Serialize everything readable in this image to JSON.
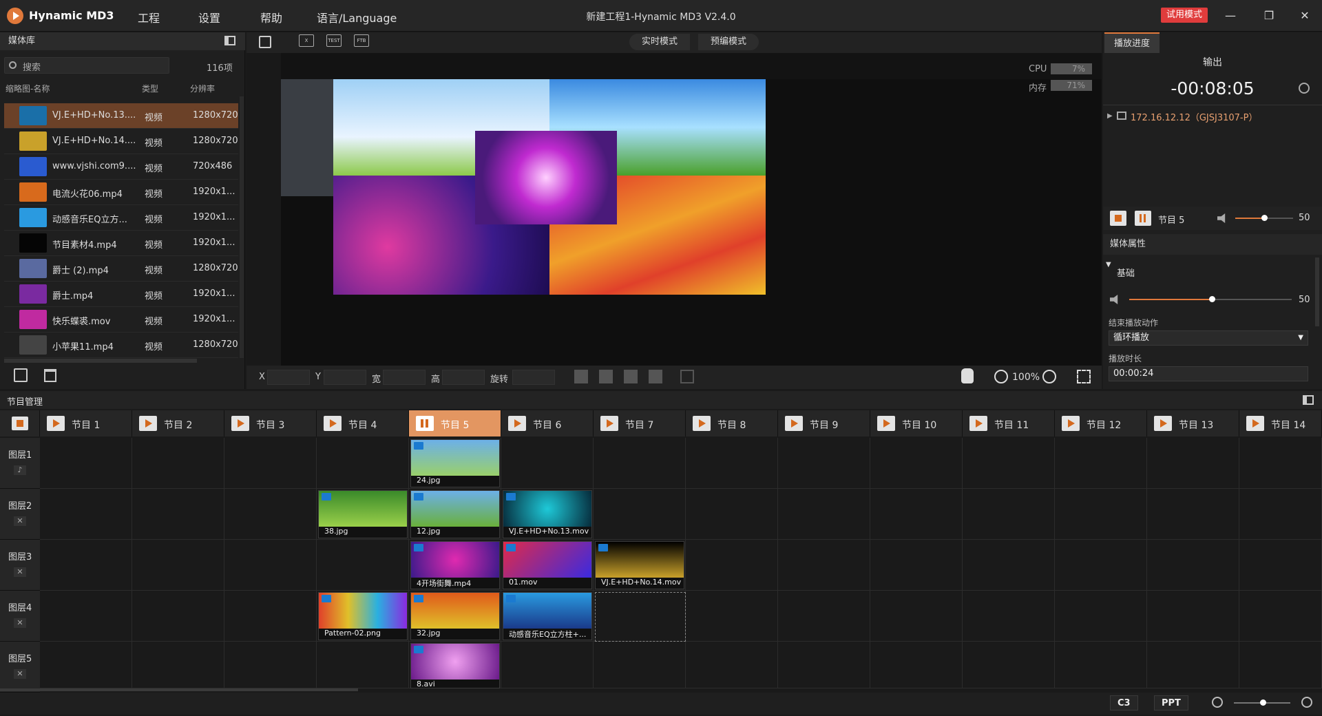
{
  "app": {
    "name": "Hynamic MD3",
    "window_title": "新建工程1-Hynamic MD3  V2.4.0",
    "trial": "试用模式",
    "menu": [
      "工程",
      "设置",
      "帮助",
      "语言/Language"
    ],
    "win_controls": [
      "—",
      "❐",
      "✕"
    ]
  },
  "media": {
    "title": "媒体库",
    "search_placeholder": "搜索",
    "count": "116项",
    "columns": [
      "缩略图-名称",
      "类型",
      "分辨率"
    ],
    "rows": [
      {
        "name": "VJ.E+HD+No.13....",
        "type": "视频",
        "res": "1280x720",
        "color": "#1a6fa8"
      },
      {
        "name": "VJ.E+HD+No.14....",
        "type": "视频",
        "res": "1280x720",
        "color": "#c9a12a"
      },
      {
        "name": "www.vjshi.com9....",
        "type": "视频",
        "res": "720x486",
        "color": "#2a5bd0"
      },
      {
        "name": "电流火花06.mp4",
        "type": "视频",
        "res": "1920x1...",
        "color": "#d86a1c"
      },
      {
        "name": "动感音乐EQ立方...",
        "type": "视频",
        "res": "1920x1...",
        "color": "#2a9ae0"
      },
      {
        "name": "节目素材4.mp4",
        "type": "视频",
        "res": "1920x1...",
        "color": "#050505"
      },
      {
        "name": "爵士 (2).mp4",
        "type": "视频",
        "res": "1280x720",
        "color": "#5a6aa0"
      },
      {
        "name": "爵士.mp4",
        "type": "视频",
        "res": "1920x1...",
        "color": "#7a2aa0"
      },
      {
        "name": "快乐蝶裘.mov",
        "type": "视频",
        "res": "1920x1...",
        "color": "#c02aa0"
      },
      {
        "name": "小苹果11.mp4",
        "type": "视频",
        "res": "1280x720",
        "color": "#444"
      }
    ]
  },
  "preview": {
    "tools": [
      "X",
      "TEST",
      "FTB"
    ],
    "modes": [
      "实时模式",
      "预编模式"
    ],
    "cpu_label": "CPU",
    "cpu": "7%",
    "mem_label": "内存",
    "mem": "71%",
    "fields": [
      "X",
      "Y",
      "宽",
      "高",
      "旋转"
    ],
    "zoom": "100%"
  },
  "right": {
    "tab": "播放进度",
    "output": "输出",
    "time": "-00:08:05",
    "device": "172.16.12.12（GJSJ3107-P）",
    "current": "节目 5",
    "volume": "50",
    "media_props": "媒体属性",
    "basic": "基础",
    "vol2": "50",
    "end_action_label": "结束播放动作",
    "end_action": "循环播放",
    "duration_label": "播放时长",
    "duration": "00:00:24"
  },
  "program": {
    "title": "节目管理",
    "tabs": [
      "节目 1",
      "节目 2",
      "节目 3",
      "节目 4",
      "节目 5",
      "节目 6",
      "节目 7",
      "节目 8",
      "节目 9",
      "节目 10",
      "节目 11",
      "节目 12",
      "节目 13",
      "节目 14"
    ],
    "layers": [
      "图层1",
      "图层2",
      "图层3",
      "图层4",
      "图层5"
    ],
    "clips": [
      {
        "layer": 0,
        "col": 4,
        "name": "24.jpg",
        "color": "linear-gradient(#6cb0e8,#9ad06a)"
      },
      {
        "layer": 1,
        "col": 3,
        "name": "38.jpg",
        "color": "linear-gradient(#3a8a2a,#9ad04a)"
      },
      {
        "layer": 1,
        "col": 4,
        "name": "12.jpg",
        "color": "linear-gradient(#6cb0e8,#6ab03a)"
      },
      {
        "layer": 1,
        "col": 5,
        "name": "VJ.E+HD+No.13.mov",
        "color": "radial-gradient(circle,#1ec9d8,#062a3a)"
      },
      {
        "layer": 2,
        "col": 4,
        "name": "4开场街舞.mp4",
        "color": "radial-gradient(circle,#e02ab0,#3a1a8a)"
      },
      {
        "layer": 2,
        "col": 5,
        "name": "01.mov",
        "color": "linear-gradient(135deg,#e02a4a,#3a2ae0)"
      },
      {
        "layer": 2,
        "col": 6,
        "name": "VJ.E+HD+No.14.mov",
        "color": "linear-gradient(#000,#c9a12a)"
      },
      {
        "layer": 3,
        "col": 3,
        "name": "Pattern-02.png",
        "color": "linear-gradient(90deg,#e0402a,#e0c02a,#2ab0e0,#8a2ae0)"
      },
      {
        "layer": 3,
        "col": 4,
        "name": "32.jpg",
        "color": "linear-gradient(#e05a1a,#e0c02a)"
      },
      {
        "layer": 3,
        "col": 5,
        "name": "动感音乐EQ立方柱+...",
        "color": "linear-gradient(#2a9ae0,#1a3a8a)"
      },
      {
        "layer": 4,
        "col": 4,
        "name": "8.avi",
        "color": "radial-gradient(circle,#f0a0f0,#6a1a8a)"
      }
    ],
    "footer": [
      "C3",
      "PPT"
    ]
  }
}
